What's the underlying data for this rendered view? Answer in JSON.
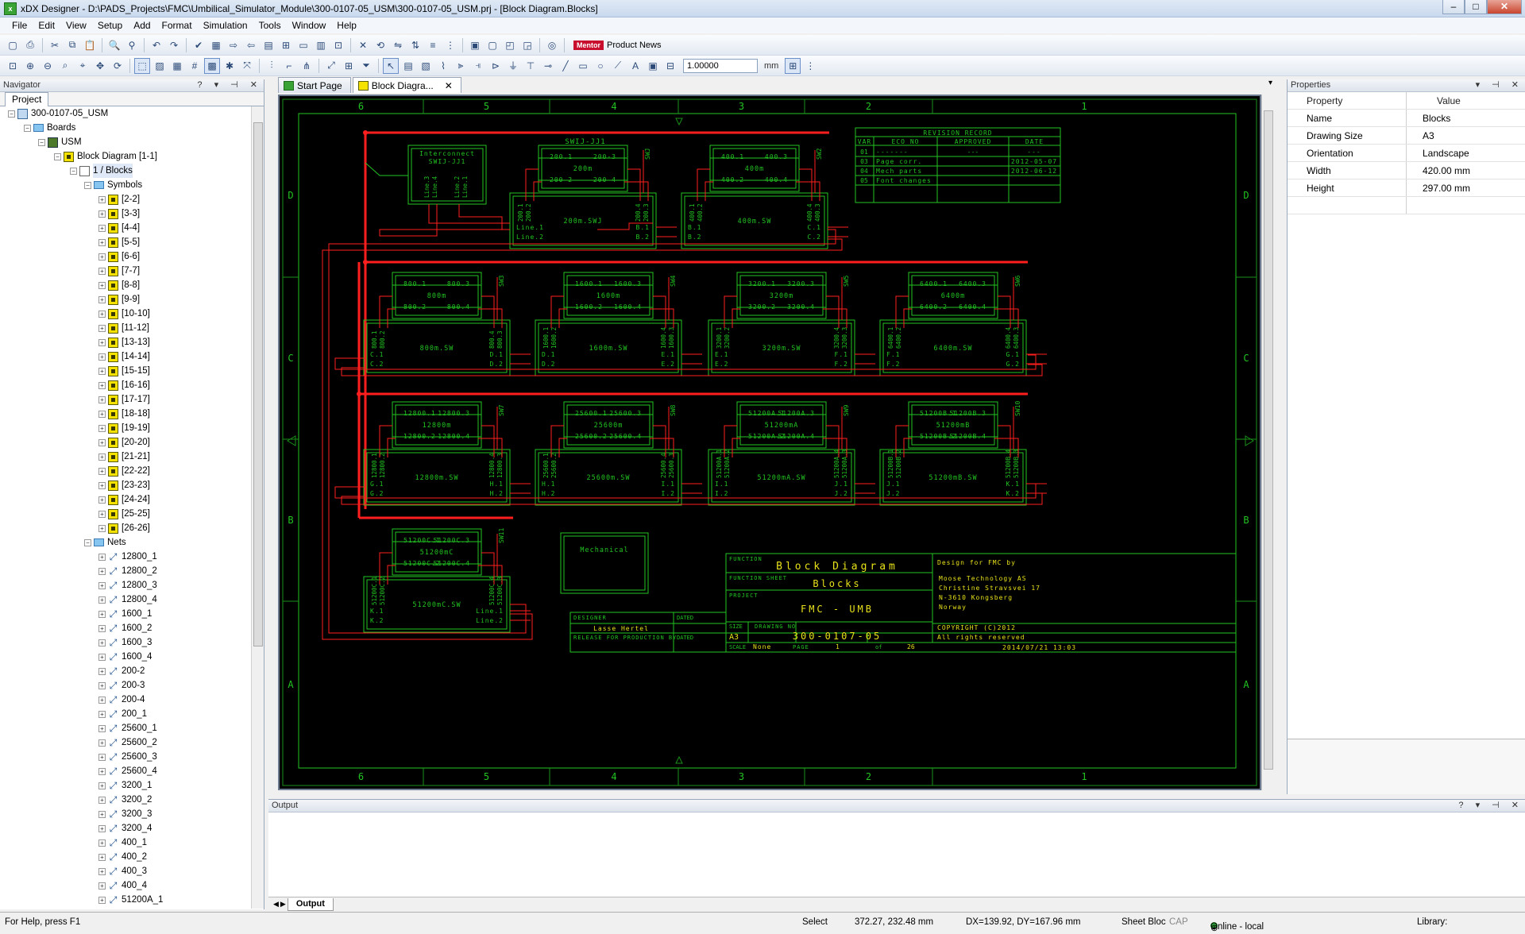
{
  "window": {
    "title": "xDX Designer - D:\\PADS_Projects\\FMC\\Umbilical_Simulator_Module\\300-0107-05_USM\\300-0107-05_USM.prj - [Block Diagram.Blocks]"
  },
  "menu": [
    "File",
    "Edit",
    "View",
    "Setup",
    "Add",
    "Format",
    "Simulation",
    "Tools",
    "Window",
    "Help"
  ],
  "toolbar": {
    "zoom_value": "1.00000",
    "unit": "mm",
    "product_news": "Product News",
    "mentor": "Mentor"
  },
  "navigator": {
    "title": "Navigator",
    "tab": "Project",
    "tree": {
      "project": "300-0107-05_USM",
      "boards": "Boards",
      "board": "USM",
      "diagram": "Block Diagram [1-1]",
      "sheet": "1 / Blocks",
      "symbols_folder": "Symbols",
      "symbols": [
        "[2-2]",
        "[3-3]",
        "[4-4]",
        "[5-5]",
        "[6-6]",
        "[7-7]",
        "[8-8]",
        "[9-9]",
        "[10-10]",
        "[11-12]",
        "[13-13]",
        "[14-14]",
        "[15-15]",
        "[16-16]",
        "[17-17]",
        "[18-18]",
        "[19-19]",
        "[20-20]",
        "[21-21]",
        "[22-22]",
        "[23-23]",
        "[24-24]",
        "[25-25]",
        "[26-26]"
      ],
      "nets_folder": "Nets",
      "nets": [
        "12800_1",
        "12800_2",
        "12800_3",
        "12800_4",
        "1600_1",
        "1600_2",
        "1600_3",
        "1600_4",
        "200-2",
        "200-3",
        "200-4",
        "200_1",
        "25600_1",
        "25600_2",
        "25600_3",
        "25600_4",
        "3200_1",
        "3200_2",
        "3200_3",
        "3200_4",
        "400_1",
        "400_2",
        "400_3",
        "400_4",
        "51200A_1"
      ]
    }
  },
  "tabs": {
    "start": "Start Page",
    "block": "Block Diagra..."
  },
  "schematic": {
    "zones_top": [
      "6",
      "5",
      "4",
      "3",
      "2",
      "1"
    ],
    "zones_side": [
      "D",
      "C",
      "B",
      "A"
    ],
    "top_label": "SWIJ-JJ1",
    "revision": {
      "title": "REVISION RECORD",
      "headers": [
        "VAR",
        "ECO NO",
        "APPROVED",
        "DATE"
      ],
      "rows": [
        {
          "var": "01",
          "eco": "-------",
          "app": "---",
          "date": "---"
        },
        {
          "var": "03",
          "eco": "Page corr.",
          "app": "",
          "date": "2012-05-07"
        },
        {
          "var": "04",
          "eco": "Mech parts",
          "app": "",
          "date": "2012-06-12"
        },
        {
          "var": "05",
          "eco": "Font changes",
          "app": "",
          "date": ""
        }
      ]
    },
    "interconnect": {
      "title": "Interconnect",
      "sub": "SWIJ-JJ1",
      "lines": [
        "Line.3",
        "Line.4",
        "Line.2",
        "Line.1"
      ]
    },
    "mods": [
      {
        "id": "200",
        "tl": "200.1",
        "tr": "200-3",
        "bl": "200-2",
        "br": "200-4",
        "center": "200m",
        "bus": "200m.SWJ",
        "sw": "SWJ",
        "pl": [
          "Line.1",
          "Line.2"
        ],
        "pr": [
          "B.1",
          "B.2"
        ],
        "vl": [
          "200.1",
          "200.2"
        ],
        "vr": [
          "200.4",
          "200.3"
        ]
      },
      {
        "id": "400",
        "tl": "400.1",
        "tr": "400.3",
        "bl": "400.2",
        "br": "400.4",
        "center": "400m",
        "bus": "400m.SW",
        "sw": "SW2",
        "pl": [
          "B.1",
          "B.2"
        ],
        "pr": [
          "C.1",
          "C.2"
        ],
        "vl": [
          "400.1",
          "400.2"
        ],
        "vr": [
          "400.4",
          "400.3"
        ]
      },
      {
        "id": "800",
        "tl": "800.1",
        "tr": "800.3",
        "bl": "800.2",
        "br": "800.4",
        "center": "800m",
        "bus": "800m.SW",
        "sw": "SW3",
        "pl": [
          "C.1",
          "C.2"
        ],
        "pr": [
          "D.1",
          "D.2"
        ],
        "vl": [
          "800.1",
          "800.2"
        ],
        "vr": [
          "800.4",
          "800.3"
        ]
      },
      {
        "id": "1600",
        "tl": "1600.1",
        "tr": "1600.3",
        "bl": "1600.2",
        "br": "1600.4",
        "center": "1600m",
        "bus": "1600m.SW",
        "sw": "SW4",
        "pl": [
          "D.1",
          "D.2"
        ],
        "pr": [
          "E.1",
          "E.2"
        ],
        "vl": [
          "1600.1",
          "1600.2"
        ],
        "vr": [
          "1600.4",
          "1600.3"
        ]
      },
      {
        "id": "3200",
        "tl": "3200.1",
        "tr": "3200.3",
        "bl": "3200.2",
        "br": "3200.4",
        "center": "3200m",
        "bus": "3200m.SW",
        "sw": "SW5",
        "pl": [
          "E.1",
          "E.2"
        ],
        "pr": [
          "F.1",
          "F.2"
        ],
        "vl": [
          "3200.1",
          "3200.2"
        ],
        "vr": [
          "3200.4",
          "3200.3"
        ]
      },
      {
        "id": "6400",
        "tl": "6400.1",
        "tr": "6400.3",
        "bl": "6400.2",
        "br": "6400.4",
        "center": "6400m",
        "bus": "6400m.SW",
        "sw": "SW6",
        "pl": [
          "F.1",
          "F.2"
        ],
        "pr": [
          "G.1",
          "G.2"
        ],
        "vl": [
          "6400.1",
          "6400.2"
        ],
        "vr": [
          "6400.4",
          "6400.3"
        ]
      },
      {
        "id": "12800",
        "tl": "12800.1",
        "tr": "12800.3",
        "bl": "12800.2",
        "br": "12800.4",
        "center": "12800m",
        "bus": "12800m.SW",
        "sw": "SW7",
        "pl": [
          "G.1",
          "G.2"
        ],
        "pr": [
          "H.1",
          "H.2"
        ],
        "vl": [
          "12800.1",
          "12800.2"
        ],
        "vr": [
          "12800.4",
          "12800.3"
        ]
      },
      {
        "id": "25600",
        "tl": "25600.1",
        "tr": "25600.3",
        "bl": "25600.2",
        "br": "25600.4",
        "center": "25600m",
        "bus": "25600m.SW",
        "sw": "SW8",
        "pl": [
          "H.1",
          "H.2"
        ],
        "pr": [
          "I.1",
          "I.2"
        ],
        "vl": [
          "25600.1",
          "25600.2"
        ],
        "vr": [
          "25600.4",
          "25600.3"
        ]
      },
      {
        "id": "51200A",
        "tl": "51200A.1",
        "tr": "51200A.3",
        "bl": "51200A.2",
        "br": "51200A.4",
        "center": "51200mA",
        "bus": "51200mA.SW",
        "sw": "SW9",
        "pl": [
          "I.1",
          "I.2"
        ],
        "pr": [
          "J.1",
          "J.2"
        ],
        "vl": [
          "51200A.1",
          "51200A.2"
        ],
        "vr": [
          "51200A.4",
          "51200A.3"
        ]
      },
      {
        "id": "51200B",
        "tl": "51200B.1",
        "tr": "51200B.3",
        "bl": "51200B.2",
        "br": "51200B.4",
        "center": "51200mB",
        "bus": "51200mB.SW",
        "sw": "SW10",
        "pl": [
          "J.1",
          "J.2"
        ],
        "pr": [
          "K.1",
          "K.2"
        ],
        "vl": [
          "51200B.1",
          "51200B.2"
        ],
        "vr": [
          "51200B.4",
          "51200B.3"
        ]
      },
      {
        "id": "51200C",
        "tl": "51200C.1",
        "tr": "51200C.3",
        "bl": "51200C.2",
        "br": "51200C.4",
        "center": "51200mC",
        "bus": "51200mC.SW",
        "sw": "SW11",
        "pl": [
          "K.1",
          "K.2"
        ],
        "pr": [
          "Line.1",
          "Line.2"
        ],
        "vl": [
          "51200C.1",
          "51200C.2"
        ],
        "vr": [
          "51200C.4",
          "51200C.3"
        ]
      }
    ],
    "mechanical": "Mechanical",
    "title_block": {
      "function_label": "FUNCTION",
      "function": "Block Diagram",
      "function_sheet_label": "FUNCTION SHEET",
      "function_sheet": "Blocks",
      "project_label": "PROJECT",
      "project": "FMC - UMB",
      "size_label": "SIZE",
      "size": "A3",
      "drawing_no_label": "DRAWING NO",
      "drawing_no": "300-0107-05",
      "scale_label": "SCALE",
      "scale": "None",
      "page_label": "PAGE",
      "page": "1",
      "of_label": "of",
      "of": "26",
      "design_for": "Design for FMC by",
      "company": [
        "Moose Technology AS",
        "Christine Stravsvei 17",
        "N-3610 Kongsberg",
        "Norway"
      ],
      "copyright": "COPYRIGHT (C)2012",
      "rights": "All rights reserved",
      "timestamp": "2014/07/21 13:03",
      "designer_label": "DESIGNER",
      "designer": "Lasse Hertel",
      "dated_label": "DATED",
      "release_label": "RELEASE FOR PRODUCTION BY"
    }
  },
  "properties": {
    "title": "Properties",
    "header": {
      "k": "Property",
      "v": "Value"
    },
    "rows": [
      {
        "k": "Name",
        "v": "Blocks"
      },
      {
        "k": "Drawing Size",
        "v": "A3"
      },
      {
        "k": "Orientation",
        "v": "Landscape"
      },
      {
        "k": "Width",
        "v": "420.00 mm"
      },
      {
        "k": "Height",
        "v": "297.00 mm"
      }
    ]
  },
  "output": {
    "title": "Output",
    "tab": "Output"
  },
  "status": {
    "help": "For Help, press F1",
    "mode": "Select",
    "coords": "372.27, 232.48 mm",
    "delta": "DX=139.92, DY=167.96 mm",
    "sheet": "Sheet Bloc",
    "caps": "CAP",
    "online": "Online - local",
    "library": "Library:"
  }
}
